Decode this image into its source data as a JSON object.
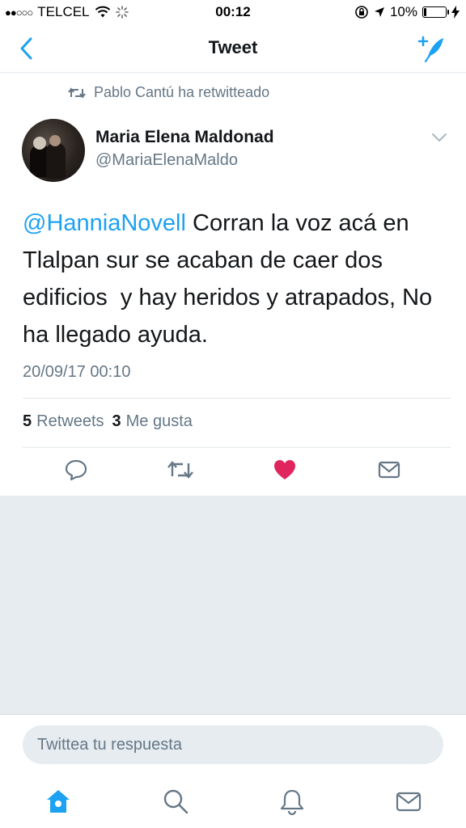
{
  "status_bar": {
    "signal": "●●○○○",
    "carrier": "TELCEL",
    "time": "00:12",
    "battery": "10%",
    "battery_level": 0.1
  },
  "nav": {
    "title": "Tweet",
    "back_icon": "chevron-left-icon",
    "compose_icon": "compose-tweet-icon"
  },
  "tweet": {
    "retweeted_by": "Pablo Cantú ha retwitteado",
    "author_name": "Maria Elena Maldonad",
    "author_handle": "@MariaElenaMaldo",
    "mention": "@HanniaNovell",
    "text": " Corran la voz acá en Tlalpan sur se acaban de caer dos edificios  y hay heridos y atrapados, No ha llegado ayuda.",
    "timestamp": "20/09/17 00:10",
    "retweets_count": "5",
    "retweets_label": "Retweets",
    "likes_count": "3",
    "likes_label": "Me gusta",
    "liked": true
  },
  "colors": {
    "accent": "#1da1f2",
    "like": "#e0245e",
    "muted": "#657786",
    "background_gray": "#e6ecf0"
  },
  "reply": {
    "placeholder": "Twittea tu respuesta"
  },
  "tabs": [
    "home-icon",
    "search-icon",
    "notifications-icon",
    "messages-icon"
  ]
}
